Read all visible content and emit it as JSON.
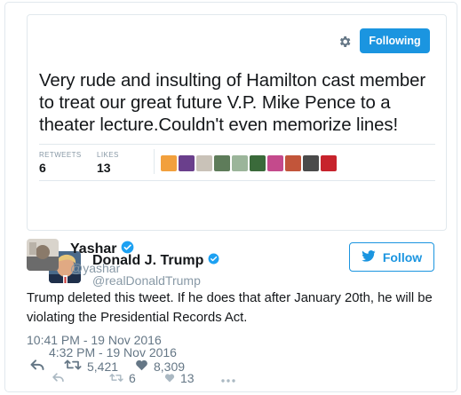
{
  "quoted_tweet": {
    "author_name": "Donald J. Trump",
    "author_handle": "@realDonaldTrump",
    "follow_label": "Following",
    "text": "Very rude and insulting of Hamilton cast member to treat our great future V.P. Mike Pence to a theater lecture.Couldn't even memorize lines!",
    "retweets_label": "RETWEETS",
    "retweets_count": "6",
    "likes_label": "LIKES",
    "likes_count": "13",
    "timestamp": "4:32 PM - 19 Nov 2016",
    "action_retweet_count": "6",
    "action_like_count": "13",
    "liker_colors": [
      "#f2a03d",
      "#6a3f8c",
      "#c9c2b8",
      "#5e7c5a",
      "#9bb59a",
      "#3a6a3a",
      "#c44a8c",
      "#c2553a",
      "#4a4a4a",
      "#c7232c"
    ]
  },
  "main_tweet": {
    "author_name": "Yashar",
    "author_handle": "@yashar",
    "follow_label": "Follow",
    "text": "Trump deleted this tweet. If he does that after January 20th, he will be violating the Presidential Records Act.",
    "timestamp": "10:41 PM - 19 Nov 2016",
    "retweet_count": "5,421",
    "like_count": "8,309"
  },
  "colors": {
    "accent": "#1b95e0",
    "muted": "#8899a6",
    "border": "#e1e8ed",
    "text": "#14171a"
  }
}
